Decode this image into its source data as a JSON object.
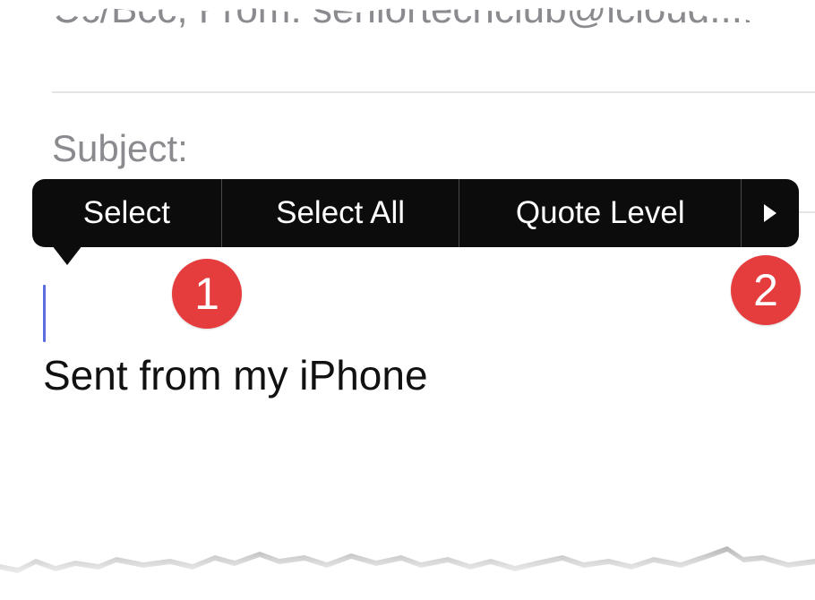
{
  "header_field": {
    "text": "Cc/Bcc, From: seniortechclub@icloud...."
  },
  "subject": {
    "label": "Subject:"
  },
  "edit_menu": {
    "items": [
      {
        "label": "Select"
      },
      {
        "label": "Select All"
      },
      {
        "label": "Quote Level"
      }
    ],
    "more_icon": "play-triangle-icon"
  },
  "badges": [
    {
      "number": "1"
    },
    {
      "number": "2"
    }
  ],
  "body": {
    "signature": "Sent from my iPhone"
  },
  "colors": {
    "menu_background": "#0c0c0c",
    "badge_red": "#e53c3e",
    "cursor_blue": "#5a6ee0",
    "placeholder_gray": "#8a8a8f"
  }
}
